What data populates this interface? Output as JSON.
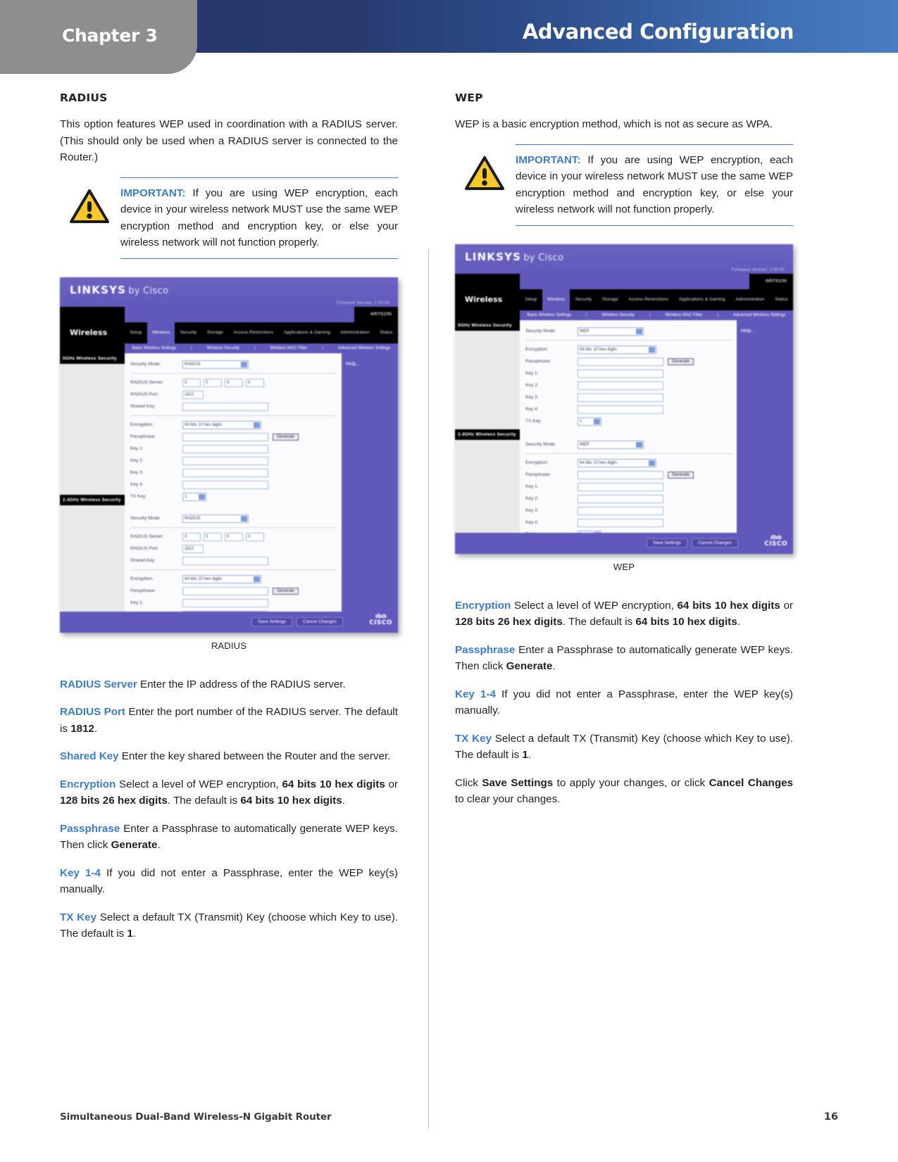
{
  "header": {
    "chapter": "Chapter 3",
    "title": "Advanced Configuration"
  },
  "footer": {
    "product": "Simultaneous Dual-Band Wireless-N Gigabit Router",
    "page_number": "16"
  },
  "colors": {
    "accent_blue": "#3c7cc3",
    "header_dark": "#25386b",
    "header_light": "#4a7cc2",
    "chapter_gray": "#8e8e8e",
    "router_purple": "#6059bb",
    "warning_yellow": "#f7c928"
  },
  "left_column": {
    "heading": "RADIUS",
    "intro": "This option features WEP used in coordination with a RADIUS server. (This should only be used when a RADIUS server is connected to the Router.)",
    "callout": {
      "label": "IMPORTANT:",
      "text": " If you are using WEP encryption, each device in your wireless network MUST use the same WEP encryption method and encryption key, or else your wireless network will not function properly."
    },
    "figure_caption": "RADIUS",
    "entries": [
      {
        "term": "RADIUS Server",
        "parts": [
          {
            "text": "  Enter the IP address of the RADIUS server.",
            "bold": false
          }
        ]
      },
      {
        "term": "RADIUS Port",
        "parts": [
          {
            "text": "  Enter the port number of the RADIUS server. The default is ",
            "bold": false
          },
          {
            "text": "1812",
            "bold": true
          },
          {
            "text": ".",
            "bold": false
          }
        ]
      },
      {
        "term": "Shared Key",
        "parts": [
          {
            "text": " Enter the key shared between the Router and the server.",
            "bold": false
          }
        ]
      },
      {
        "term": "Encryption",
        "parts": [
          {
            "text": " Select a level of WEP encryption, ",
            "bold": false
          },
          {
            "text": "64 bits 10 hex digits",
            "bold": true
          },
          {
            "text": " or ",
            "bold": false
          },
          {
            "text": "128 bits 26 hex digits",
            "bold": true
          },
          {
            "text": ". The default is ",
            "bold": false
          },
          {
            "text": "64 bits 10 hex digits",
            "bold": true
          },
          {
            "text": ".",
            "bold": false
          }
        ]
      },
      {
        "term": "Passphrase",
        "parts": [
          {
            "text": "  Enter a Passphrase to automatically generate WEP keys. Then click ",
            "bold": false
          },
          {
            "text": "Generate",
            "bold": true
          },
          {
            "text": ".",
            "bold": false
          }
        ]
      },
      {
        "term": "Key 1-4",
        "parts": [
          {
            "text": "  If you did not enter a Passphrase, enter the WEP key(s) manually.",
            "bold": false
          }
        ]
      },
      {
        "term": "TX Key",
        "parts": [
          {
            "text": "  Select a default TX (Transmit) Key (choose which Key to use). The default is ",
            "bold": false
          },
          {
            "text": "1",
            "bold": true
          },
          {
            "text": ".",
            "bold": false
          }
        ]
      }
    ]
  },
  "right_column": {
    "heading": "WEP",
    "intro": "WEP is a basic encryption method, which is not as secure as WPA.",
    "callout": {
      "label": "IMPORTANT:",
      "text": " If you are using WEP encryption, each device in your wireless network MUST use the same WEP encryption method and encryption key, or else your wireless network will not function properly."
    },
    "figure_caption": "WEP",
    "entries": [
      {
        "term": "Encryption",
        "parts": [
          {
            "text": " Select a level of WEP encryption, ",
            "bold": false
          },
          {
            "text": "64 bits 10 hex digits",
            "bold": true
          },
          {
            "text": " or ",
            "bold": false
          },
          {
            "text": "128 bits 26 hex digits",
            "bold": true
          },
          {
            "text": ". The default is ",
            "bold": false
          },
          {
            "text": "64 bits 10 hex digits",
            "bold": true
          },
          {
            "text": ".",
            "bold": false
          }
        ]
      },
      {
        "term": "Passphrase",
        "parts": [
          {
            "text": "  Enter a Passphrase to automatically generate WEP keys. Then click ",
            "bold": false
          },
          {
            "text": "Generate",
            "bold": true
          },
          {
            "text": ".",
            "bold": false
          }
        ]
      },
      {
        "term": "Key 1-4",
        "parts": [
          {
            "text": "  If you did not enter a Passphrase, enter the WEP key(s) manually.",
            "bold": false
          }
        ]
      },
      {
        "term": "TX Key",
        "parts": [
          {
            "text": "  Select a default TX (Transmit) Key (choose which Key to use). The default is ",
            "bold": false
          },
          {
            "text": "1",
            "bold": true
          },
          {
            "text": ".",
            "bold": false
          }
        ]
      },
      {
        "term": "",
        "parts": [
          {
            "text": "Click ",
            "bold": false
          },
          {
            "text": "Save Settings",
            "bold": true
          },
          {
            "text": " to apply your changes, or click ",
            "bold": false
          },
          {
            "text": "Cancel Changes",
            "bold": true
          },
          {
            "text": " to clear your changes.",
            "bold": false
          }
        ]
      }
    ]
  },
  "router_ui": {
    "brand": "LINKSYS",
    "brand_suffix": "by Cisco",
    "firmware": "Firmware Version: 1.00.00",
    "model": "WRT610N",
    "section_title": "Wireless",
    "tabs": [
      "Setup",
      "Wireless",
      "Security",
      "Storage",
      "Access Restrictions",
      "Applications & Gaming",
      "Administration",
      "Status"
    ],
    "active_tab": "Wireless",
    "subtabs": [
      "Basic Wireless Settings",
      "Wireless Security",
      "Wireless MAC Filter",
      "Advanced Wireless Settings"
    ],
    "side_sections": [
      "5GHz Wireless Security",
      "2.4GHz Wireless Security"
    ],
    "help_label": "Help...",
    "cisco_logo": "CISCO",
    "buttons": {
      "save": "Save Settings",
      "cancel": "Cancel Changes",
      "generate": "Generate"
    },
    "radius_form": {
      "security_mode_label": "Security Mode:",
      "security_mode_value": "RADIUS",
      "radius_server_label": "RADIUS Server:",
      "radius_server_octets": [
        "0",
        "0",
        "0",
        "0"
      ],
      "radius_port_label": "RADIUS Port:",
      "radius_port_value": "1812",
      "shared_key_label": "Shared Key:",
      "shared_key_value": "",
      "encryption_label": "Encryption:",
      "encryption_value": "64 bits 10 hex digits",
      "passphrase_label": "Passphrase:",
      "passphrase_value": "",
      "key_labels": [
        "Key 1:",
        "Key 2:",
        "Key 3:",
        "Key 4:"
      ],
      "tx_key_label": "TX Key:",
      "tx_key_value": "1"
    },
    "wep_form": {
      "security_mode_label": "Security Mode:",
      "security_mode_value": "WEP",
      "encryption_label": "Encryption:",
      "encryption_value": "64 bits 10 hex digits",
      "passphrase_label": "Passphrase:",
      "passphrase_value": "",
      "key_labels": [
        "Key 1:",
        "Key 2:",
        "Key 3:",
        "Key 4:"
      ],
      "tx_key_label": "TX Key:",
      "tx_key_value": "1"
    }
  }
}
